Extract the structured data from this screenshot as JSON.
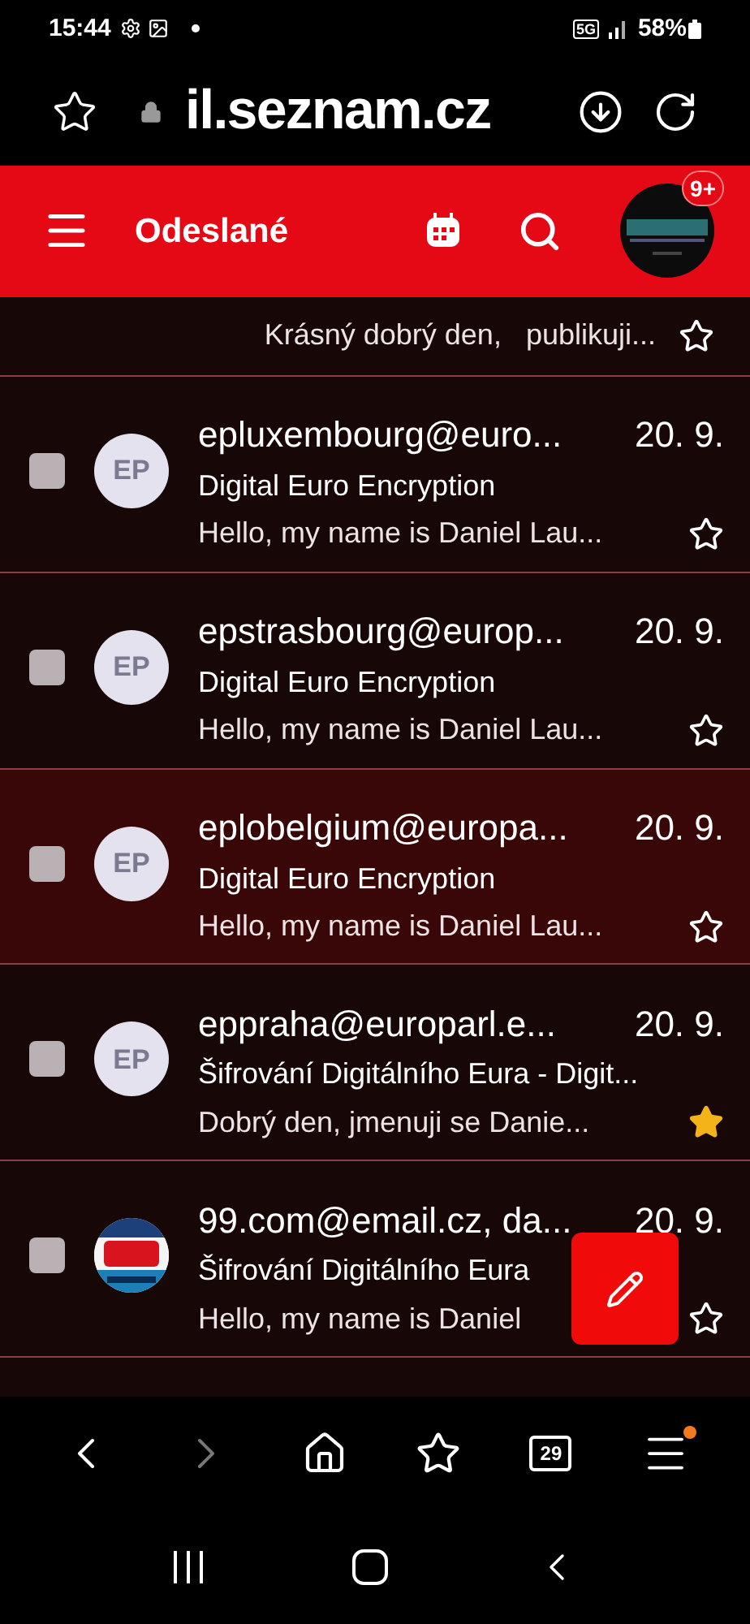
{
  "status_bar": {
    "time": "15:44",
    "network": "5G",
    "battery": "58%"
  },
  "browser": {
    "url": "il.seznam.cz"
  },
  "header": {
    "title": "Odeslané",
    "badge": "9+"
  },
  "partial_row": {
    "preview": "Krásný dobrý den,   publikuji...",
    "starred": false
  },
  "messages": [
    {
      "sender": "epluxembourg@euro...",
      "date": "20. 9.",
      "subject": "Digital Euro Encryption",
      "preview": "Hello, my name is Daniel Lau...",
      "avatar": {
        "kind": "initials",
        "text": "EP"
      },
      "starred": false,
      "highlighted": false
    },
    {
      "sender": "epstrasbourg@europ...",
      "date": "20. 9.",
      "subject": "Digital Euro Encryption",
      "preview": "Hello, my name is Daniel Lau...",
      "avatar": {
        "kind": "initials",
        "text": "EP"
      },
      "starred": false,
      "highlighted": false
    },
    {
      "sender": "eplobelgium@europa...",
      "date": "20. 9.",
      "subject": "Digital Euro Encryption",
      "preview": "Hello, my name is Daniel Lau...",
      "avatar": {
        "kind": "initials",
        "text": "EP"
      },
      "starred": false,
      "highlighted": true
    },
    {
      "sender": "eppraha@europarl.e...",
      "date": "20. 9.",
      "subject": "Šifrování Digitálního Eura - Digit...",
      "preview": "Dobrý den,  jmenuji se Danie...",
      "avatar": {
        "kind": "initials",
        "text": "EP"
      },
      "starred": true,
      "highlighted": false
    },
    {
      "sender": "99.com@email.cz, da...",
      "date": "20. 9.",
      "subject": "Šifrování Digitálního Eura",
      "preview": "Hello, my name is Daniel",
      "starred": false,
      "highlighted": false
    }
  ],
  "browser_toolbar": {
    "tabs_count": "29",
    "menu_notification": true
  }
}
